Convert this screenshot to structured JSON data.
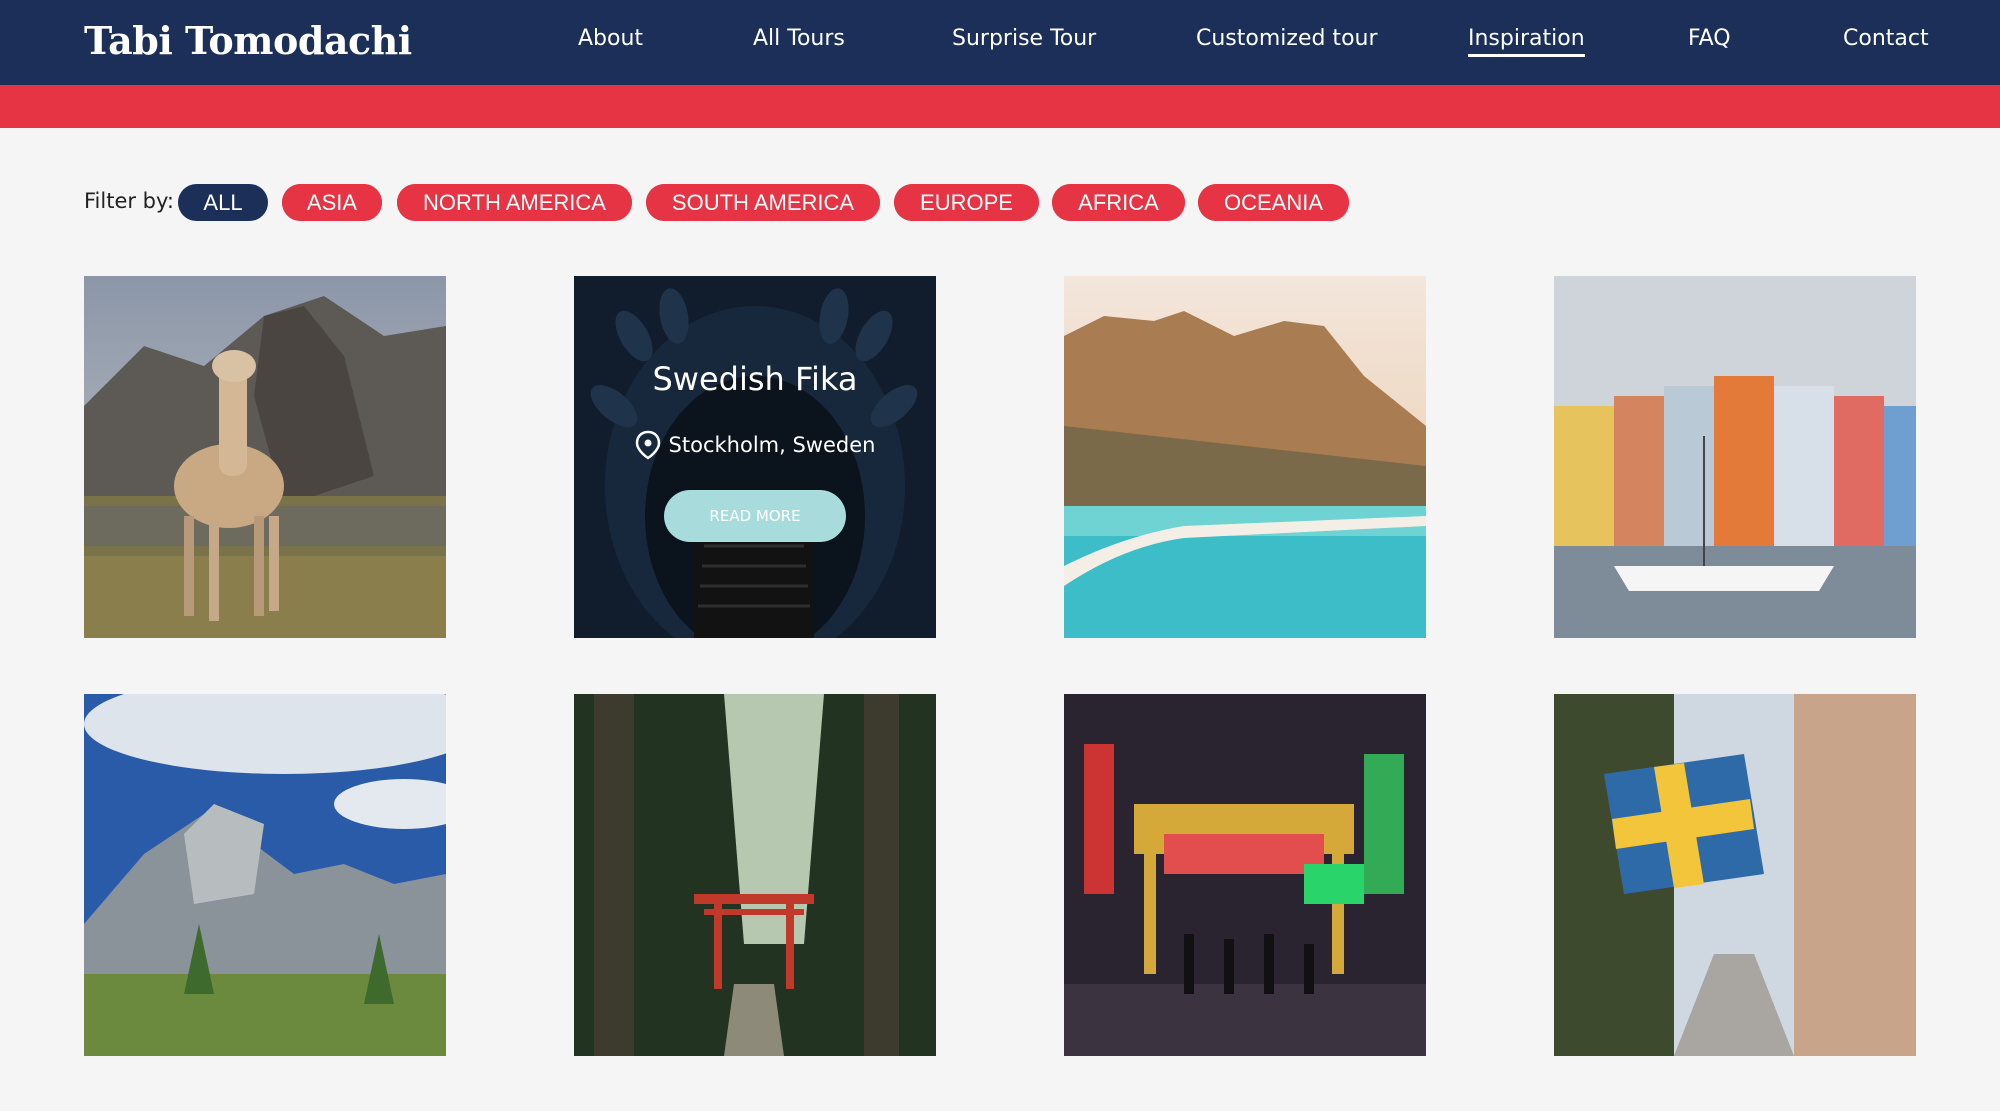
{
  "header": {
    "logo": "Tabi Tomodachi",
    "nav": [
      {
        "label": "About"
      },
      {
        "label": "All Tours"
      },
      {
        "label": "Surprise Tour"
      },
      {
        "label": "Customized tour"
      },
      {
        "label": "Inspiration",
        "active": true
      },
      {
        "label": "FAQ"
      },
      {
        "label": "Contact"
      }
    ]
  },
  "filter": {
    "label": "Filter by:",
    "options": [
      "ALL",
      "ASIA",
      "NORTH AMERICA",
      "SOUTH AMERICA",
      "EUROPE",
      "AFRICA",
      "OCEANIA"
    ],
    "selected": "ALL"
  },
  "tiles": [
    {
      "image": "llama-mountains-photo"
    },
    {
      "image": "stockholm-subway-photo",
      "title": "Swedish Fika",
      "location": "Stockholm, Sweden",
      "button": "READ MORE"
    },
    {
      "image": "coastal-mountains-photo"
    },
    {
      "image": "colorful-harbor-photo"
    },
    {
      "image": "valley-mountains-photo"
    },
    {
      "image": "forest-torii-gate-photo"
    },
    {
      "image": "night-market-photo"
    },
    {
      "image": "swedish-flag-street-photo"
    }
  ],
  "colors": {
    "navy": "#1b2f59",
    "red": "#e63444",
    "accent": "#a8dcdc",
    "background": "#f5f5f5"
  }
}
